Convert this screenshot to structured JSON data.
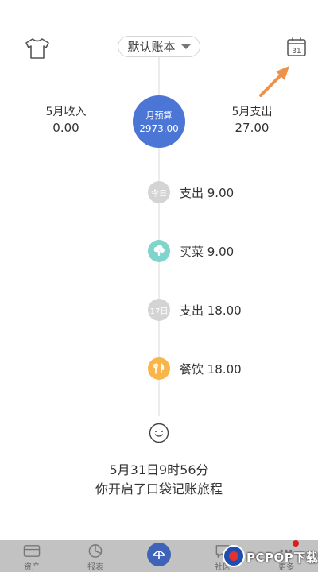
{
  "header": {
    "book_name": "默认账本",
    "calendar_day": "31"
  },
  "summary": {
    "income_label": "5月收入",
    "income_value": "0.00",
    "budget_label": "月预算",
    "budget_value": "2973.00",
    "expense_label": "5月支出",
    "expense_value": "27.00"
  },
  "timeline": [
    {
      "badge": "今日",
      "text": "支出 9.00",
      "kind": "date"
    },
    {
      "badge": "",
      "text": "买菜 9.00",
      "kind": "veggie-icon"
    },
    {
      "badge": "17日",
      "text": "支出 18.00",
      "kind": "date"
    },
    {
      "badge": "",
      "text": "餐饮 18.00",
      "kind": "dining-icon"
    }
  ],
  "start": {
    "date_text": "5月31日9时56分",
    "message": "你开启了口袋记账旅程"
  },
  "tabbar": {
    "tabs": [
      {
        "label": "资产",
        "icon": "wallet-icon"
      },
      {
        "label": "报表",
        "icon": "chart-icon"
      },
      {
        "label": "社区",
        "icon": "community-icon"
      },
      {
        "label": "更多",
        "icon": "more-icon"
      }
    ],
    "center_icon": "record-icon"
  },
  "watermark": {
    "text": "PCPOP下载"
  },
  "colors": {
    "accent": "#4b76d6",
    "arrow": "#f0914a",
    "veggie": "#7fd4cc",
    "dining": "#f7b54a"
  }
}
